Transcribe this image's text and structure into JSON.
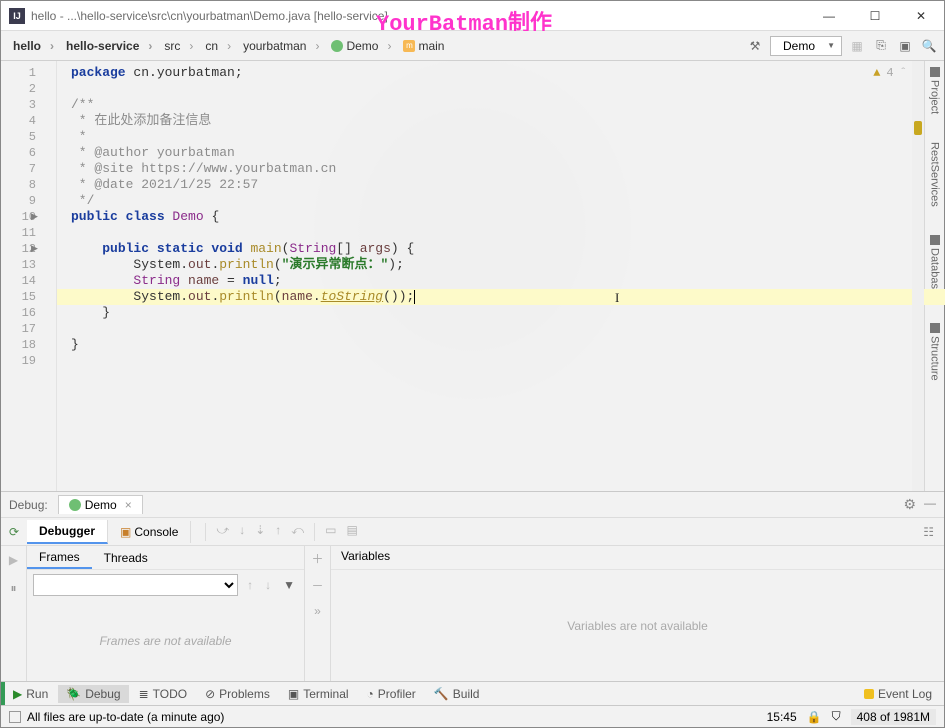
{
  "window": {
    "title": "hello - ...\\hello-service\\src\\cn\\yourbatman\\Demo.java [hello-service]",
    "watermark": "YourBatman制作"
  },
  "breadcrumbs": [
    "hello",
    "hello-service",
    "src",
    "cn",
    "yourbatman",
    "Demo",
    "main"
  ],
  "run_config": {
    "label": "Demo"
  },
  "right_rail": [
    "Project",
    "RestServices",
    "Database",
    "Structure"
  ],
  "editor": {
    "warnings": "4",
    "lines": [
      {
        "n": 1,
        "ind": 0,
        "tokens": [
          {
            "t": "package ",
            "c": "kw"
          },
          {
            "t": "cn.yourbatman",
            "c": ""
          },
          {
            "t": ";",
            "c": ""
          }
        ]
      },
      {
        "n": 2,
        "ind": 0,
        "tokens": []
      },
      {
        "n": 3,
        "ind": 0,
        "tokens": [
          {
            "t": "/**",
            "c": "cm"
          }
        ]
      },
      {
        "n": 4,
        "ind": 0,
        "tokens": [
          {
            "t": " * 在此处添加备注信息",
            "c": "cm"
          }
        ]
      },
      {
        "n": 5,
        "ind": 0,
        "tokens": [
          {
            "t": " *",
            "c": "cm"
          }
        ]
      },
      {
        "n": 6,
        "ind": 0,
        "tokens": [
          {
            "t": " * @author yourbatman",
            "c": "cm"
          }
        ]
      },
      {
        "n": 7,
        "ind": 0,
        "tokens": [
          {
            "t": " * @site https://www.yourbatman.cn",
            "c": "cm"
          }
        ]
      },
      {
        "n": 8,
        "ind": 0,
        "tokens": [
          {
            "t": " * @date 2021/1/25 22:57",
            "c": "cm"
          }
        ]
      },
      {
        "n": 9,
        "ind": 0,
        "tokens": [
          {
            "t": " */",
            "c": "cm"
          }
        ]
      },
      {
        "n": 10,
        "ind": 0,
        "arrow": true,
        "tokens": [
          {
            "t": "public class ",
            "c": "kw"
          },
          {
            "t": "Demo",
            "c": "cls"
          },
          {
            "t": " {",
            "c": ""
          }
        ]
      },
      {
        "n": 11,
        "ind": 0,
        "tokens": []
      },
      {
        "n": 12,
        "ind": 1,
        "arrow": true,
        "tokens": [
          {
            "t": "public static void ",
            "c": "kw"
          },
          {
            "t": "main",
            "c": "mth"
          },
          {
            "t": "(",
            "c": ""
          },
          {
            "t": "String",
            "c": "cls"
          },
          {
            "t": "[] ",
            "c": ""
          },
          {
            "t": "args",
            "c": "var"
          },
          {
            "t": ") {",
            "c": ""
          }
        ]
      },
      {
        "n": 13,
        "ind": 2,
        "tokens": [
          {
            "t": "System.",
            "c": ""
          },
          {
            "t": "out",
            "c": "var"
          },
          {
            "t": ".",
            "c": ""
          },
          {
            "t": "println",
            "c": "mth"
          },
          {
            "t": "(",
            "c": ""
          },
          {
            "t": "\"演示异常断点：\"",
            "c": "str"
          },
          {
            "t": ");",
            "c": ""
          }
        ]
      },
      {
        "n": 14,
        "ind": 2,
        "tokens": [
          {
            "t": "String ",
            "c": "cls"
          },
          {
            "t": "name",
            "c": "var"
          },
          {
            "t": " = ",
            "c": ""
          },
          {
            "t": "null",
            "c": "kw"
          },
          {
            "t": ";",
            "c": ""
          }
        ]
      },
      {
        "n": 15,
        "ind": 2,
        "hl": true,
        "tokens": [
          {
            "t": "System.",
            "c": ""
          },
          {
            "t": "out",
            "c": "var"
          },
          {
            "t": ".",
            "c": ""
          },
          {
            "t": "println",
            "c": "mth"
          },
          {
            "t": "(",
            "c": ""
          },
          {
            "t": "name",
            "c": "var"
          },
          {
            "t": ".",
            "c": ""
          },
          {
            "t": "toString",
            "c": "mth-i"
          },
          {
            "t": "());",
            "c": ""
          }
        ],
        "caret": true
      },
      {
        "n": 16,
        "ind": 1,
        "tokens": [
          {
            "t": "}",
            "c": ""
          }
        ]
      },
      {
        "n": 17,
        "ind": 0,
        "tokens": []
      },
      {
        "n": 18,
        "ind": 0,
        "tokens": [
          {
            "t": "}",
            "c": ""
          }
        ]
      },
      {
        "n": 19,
        "ind": 0,
        "tokens": []
      }
    ]
  },
  "debug": {
    "title": "Debug:",
    "config": "Demo",
    "tabs": {
      "debugger": "Debugger",
      "console": "Console"
    },
    "frames": {
      "tab": "Frames",
      "threads": "Threads",
      "empty": "Frames are not available"
    },
    "variables": {
      "tab": "Variables",
      "empty": "Variables are not available"
    }
  },
  "bottom": {
    "run": "Run",
    "debug": "Debug",
    "todo": "TODO",
    "problems": "Problems",
    "terminal": "Terminal",
    "profiler": "Profiler",
    "build": "Build",
    "event_log": "Event Log"
  },
  "status": {
    "msg": "All files are up-to-date (a minute ago)",
    "pos": "15:45",
    "mem": "408 of 1981M"
  }
}
